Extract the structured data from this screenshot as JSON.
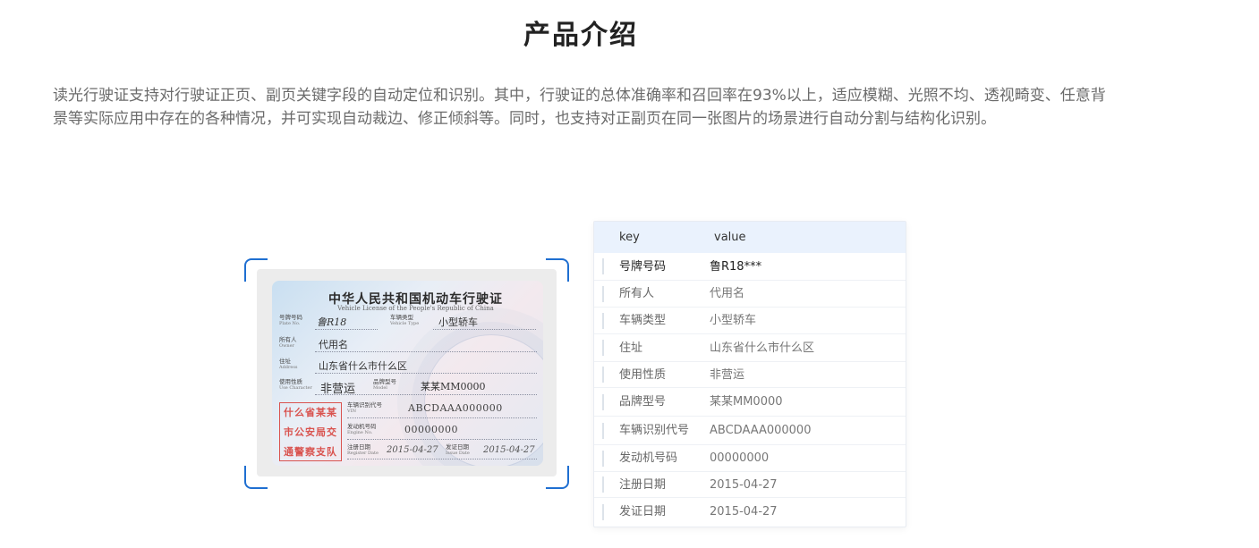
{
  "section": {
    "title": "产品介绍",
    "intro": "读光行驶证支持对行驶证正页、副页关键字段的自动定位和识别。其中，行驶证的总体准确率和召回率在93%以上，适应模糊、光照不均、透视畸变、任意背景等实际应用中存在的各种情况，并可实现自动裁边、修正倾斜等。同时，也支持对正副页在同一张图片的场景进行自动分割与结构化识别。"
  },
  "license": {
    "title": "中华人民共和国机动车行驶证",
    "subtitle": "Vehicle License of the People's Republic of China",
    "plate_label": "号牌号码",
    "plate_label_en": "Plate No.",
    "plate_value": "鲁R18",
    "type_label": "车辆类型",
    "type_label_en": "Vehicle Type",
    "type_value": "小型轿车",
    "owner_label": "所有人",
    "owner_label_en": "Owner",
    "owner_value": "代用名",
    "address_label": "住址",
    "address_label_en": "Address",
    "address_value": "山东省什么市什么区",
    "use_label": "使用性质",
    "use_label_en": "Use Character",
    "use_value": "非营运",
    "model_label": "品牌型号",
    "model_label_en": "Model",
    "model_value": "某某MM0000",
    "vin_label": "车辆识别代号",
    "vin_label_en": "VIN",
    "vin_value": "ABCDAAA000000",
    "engine_label": "发动机号码",
    "engine_label_en": "Engine No.",
    "engine_value": "00000000",
    "register_label": "注册日期",
    "register_label_en": "Register Date",
    "register_value": "2015-04-27",
    "issue_label": "发证日期",
    "issue_label_en": "Issue Date",
    "issue_value": "2015-04-27",
    "stamp_lines": [
      "什么省某某",
      "市公安局交",
      "通警察支队"
    ]
  },
  "table": {
    "header_key": "key",
    "header_value": "value",
    "rows": [
      {
        "key": "号牌号码",
        "value": "鲁R18***"
      },
      {
        "key": "所有人",
        "value": "代用名"
      },
      {
        "key": "车辆类型",
        "value": "小型轿车"
      },
      {
        "key": "住址",
        "value": "山东省什么市什么区"
      },
      {
        "key": "使用性质",
        "value": "非营运"
      },
      {
        "key": "品牌型号",
        "value": "某某MM0000"
      },
      {
        "key": "车辆识别代号",
        "value": "ABCDAAA000000"
      },
      {
        "key": "发动机号码",
        "value": "00000000"
      },
      {
        "key": "注册日期",
        "value": "2015-04-27"
      },
      {
        "key": "发证日期",
        "value": "2015-04-27"
      }
    ]
  },
  "colors": {
    "accent": "#1f6fd1",
    "table_header_bg": "#eaf2fd",
    "stamp_red": "#d9534f"
  }
}
